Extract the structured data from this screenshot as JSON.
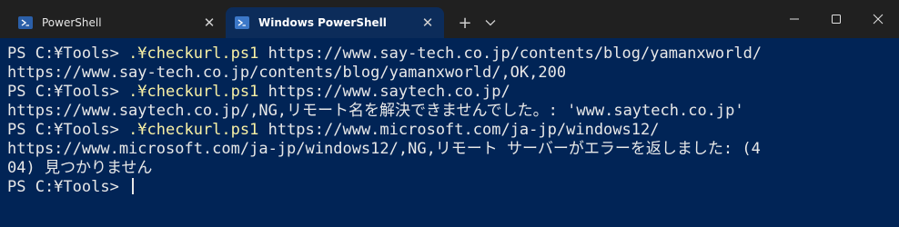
{
  "tabs": [
    {
      "label": "PowerShell",
      "active": false
    },
    {
      "label": "Windows PowerShell",
      "active": true
    }
  ],
  "new_tab_label": "+",
  "terminal": {
    "lines": [
      {
        "prompt": "PS C:¥Tools> ",
        "cmd": ".¥checkurl.ps1",
        "args": " https://www.say-tech.co.jp/contents/blog/yamanxworld/"
      },
      {
        "text": "https://www.say-tech.co.jp/contents/blog/yamanxworld/,OK,200"
      },
      {
        "prompt": "PS C:¥Tools> ",
        "cmd": ".¥checkurl.ps1",
        "args": " https://www.saytech.co.jp/"
      },
      {
        "text": "https://www.saytech.co.jp/,NG,リモート名を解決できませんでした。: 'www.saytech.co.jp'"
      },
      {
        "prompt": "PS C:¥Tools> ",
        "cmd": ".¥checkurl.ps1",
        "args": " https://www.microsoft.com/ja-jp/windows12/"
      },
      {
        "text": "https://www.microsoft.com/ja-jp/windows12/,NG,リモート サーバーがエラーを返しました: (4"
      },
      {
        "text": "04) 見つかりません"
      },
      {
        "prompt": "PS C:¥Tools> "
      }
    ]
  },
  "colors": {
    "terminal_bg": "#012456",
    "command": "#f9f1a5",
    "text": "#e8e8e8",
    "titlebar": "#202020"
  }
}
